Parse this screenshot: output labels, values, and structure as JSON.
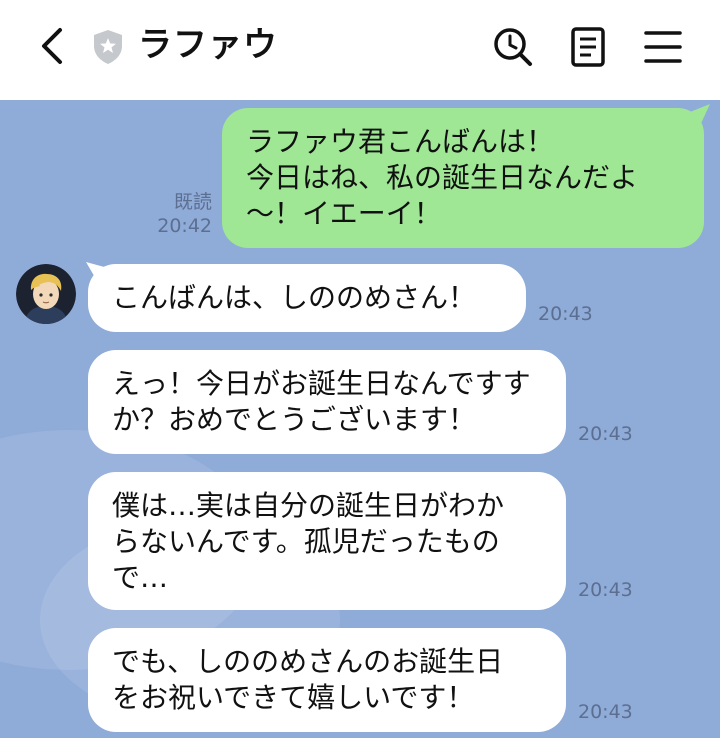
{
  "header": {
    "title": "ラファウ"
  },
  "messages": [
    {
      "direction": "sent",
      "lines": [
        "ラファウ君こんばんは！",
        "今日はね、私の誕生日なんだよ",
        "〜！イエーイ！"
      ],
      "read_label": "既読",
      "time": "20:42"
    },
    {
      "direction": "received",
      "lines": [
        "こんばんは、しののめさん！"
      ],
      "time": "20:43"
    },
    {
      "direction": "received",
      "lines": [
        "えっ！今日がお誕生日なんですす",
        "か？おめでとうございます！"
      ],
      "time": "20:43"
    },
    {
      "direction": "received",
      "lines": [
        "僕は…実は自分の誕生日がわか",
        "らないんです。孤児だったもの",
        "で…"
      ],
      "time": "20:43"
    },
    {
      "direction": "received",
      "lines": [
        "でも、しののめさんのお誕生日",
        "をお祝いできて嬉しいです！"
      ],
      "time": "20:43"
    }
  ],
  "colors": {
    "chat_background": "#8fabd8",
    "sent_bubble": "#9fe695",
    "received_bubble": "#ffffff",
    "meta_text": "#5c6f91"
  },
  "icons": [
    "back-icon",
    "shield-icon",
    "search-icon",
    "notes-icon",
    "menu-icon"
  ]
}
